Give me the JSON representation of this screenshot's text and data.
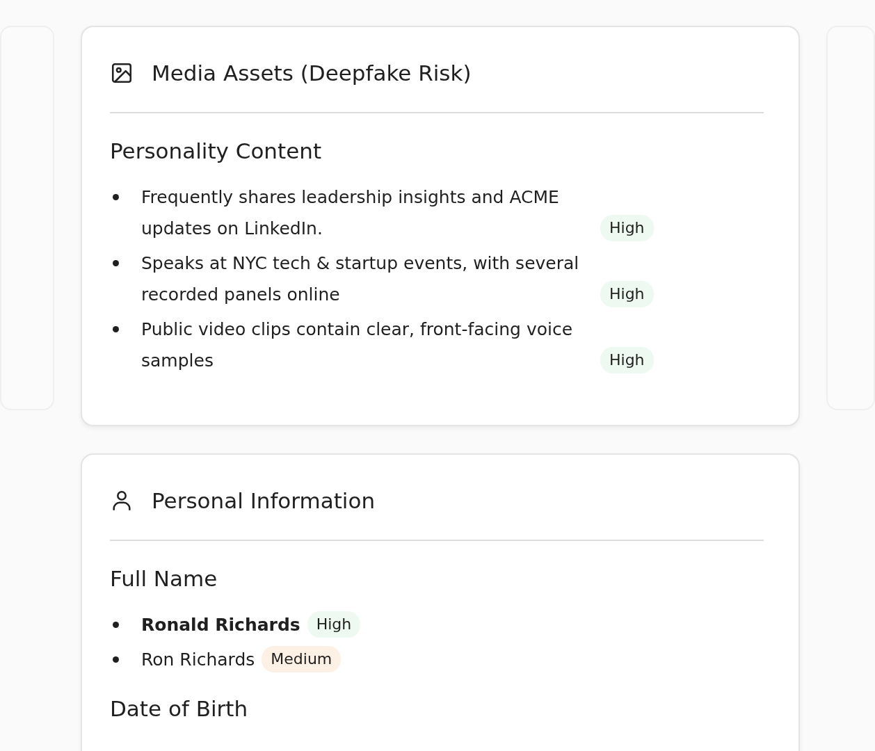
{
  "cards": [
    {
      "title": "Media Assets (Deepfake Risk)",
      "sections": [
        {
          "heading": "Personality Content",
          "items": [
            {
              "text": "Frequently shares leadership insights and ACME updates on LinkedIn.",
              "bold": false,
              "badge": {
                "label": "High",
                "kind": "high"
              }
            },
            {
              "text": "Speaks at NYC tech & startup events, with several recorded panels online",
              "bold": false,
              "badge": {
                "label": "High",
                "kind": "high"
              }
            },
            {
              "text": "Public video clips contain clear, front-facing voice samples",
              "bold": false,
              "badge": {
                "label": "High",
                "kind": "high"
              }
            }
          ]
        }
      ]
    },
    {
      "title": "Personal Information",
      "sections": [
        {
          "heading": "Full Name",
          "items": [
            {
              "text": "Ronald Richards",
              "bold": true,
              "badge": {
                "label": "High",
                "kind": "high"
              }
            },
            {
              "text": "Ron Richards",
              "bold": false,
              "badge": {
                "label": "Medium",
                "kind": "medium"
              }
            }
          ]
        },
        {
          "heading": "Date of Birth"
        }
      ]
    }
  ]
}
